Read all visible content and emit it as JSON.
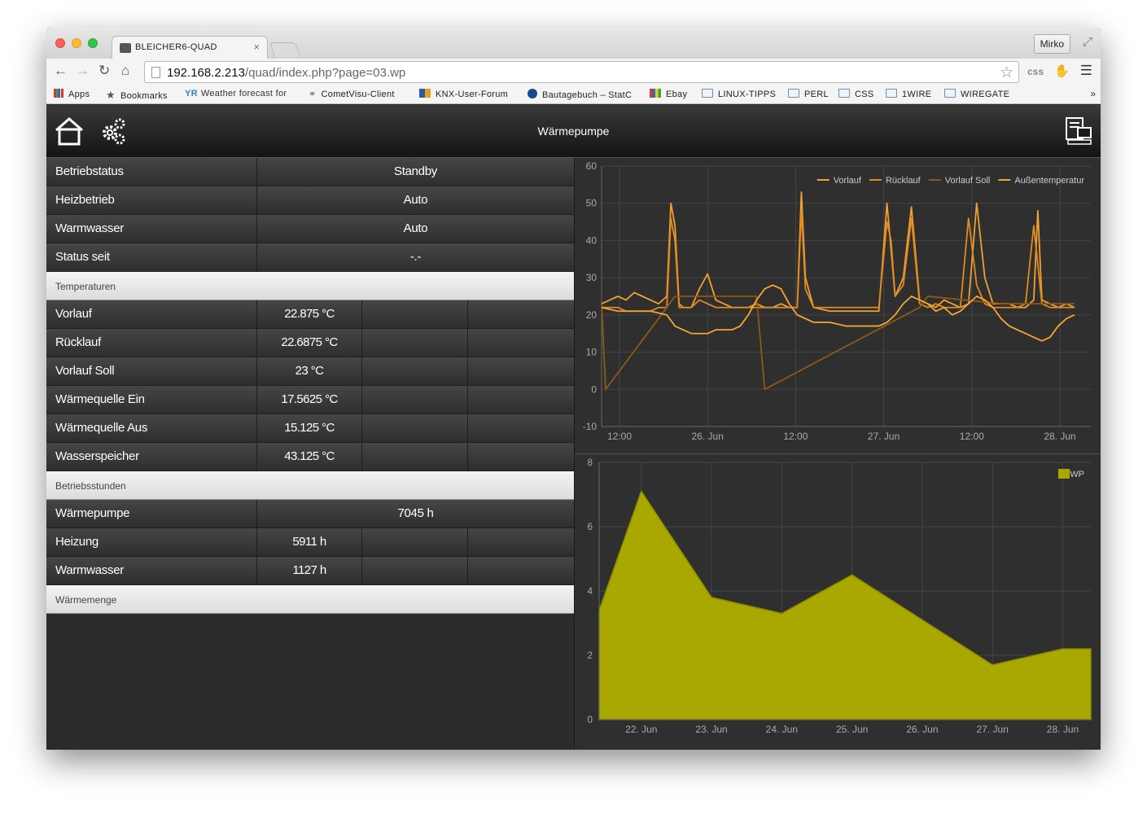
{
  "browser": {
    "tab_title": "BLEICHER6-QUAD",
    "profile": "Mirko",
    "url_host": "192.168.2.213",
    "url_path": "/quad/index.php?page=03.wp",
    "extension_label": "css",
    "bookmarks": [
      {
        "label": "Apps",
        "icon": "apps-grid-icon"
      },
      {
        "label": "Bookmarks",
        "icon": "star-icon"
      },
      {
        "label": "Weather forecast for",
        "icon": "yr-icon"
      },
      {
        "label": "CometVisu-Client",
        "icon": "link-icon"
      },
      {
        "label": "KNX-User-Forum",
        "icon": "knx-icon"
      },
      {
        "label": "Bautagebuch – StatC",
        "icon": "globe-icon"
      },
      {
        "label": "Ebay",
        "icon": "bag-icon"
      },
      {
        "label": "LINUX-TIPPS",
        "icon": "folder-icon"
      },
      {
        "label": "PERL",
        "icon": "folder-icon"
      },
      {
        "label": "CSS",
        "icon": "folder-icon"
      },
      {
        "label": "1WIRE",
        "icon": "folder-icon"
      },
      {
        "label": "WIREGATE",
        "icon": "folder-icon"
      }
    ]
  },
  "app": {
    "title": "Wärmepumpe"
  },
  "status_rows": [
    {
      "label": "Betriebstatus",
      "value": "Standby"
    },
    {
      "label": "Heizbetrieb",
      "value": "Auto"
    },
    {
      "label": "Warmwasser",
      "value": "Auto"
    },
    {
      "label": "Status seit",
      "value": "-.-"
    }
  ],
  "sections": {
    "temperaturen": "Temperaturen",
    "betriebsstunden": "Betriebsstunden",
    "waermemenge": "Wärmemenge"
  },
  "temperature_rows": [
    {
      "label": "Vorlauf",
      "value": "22.875 °C"
    },
    {
      "label": "Rücklauf",
      "value": "22.6875 °C"
    },
    {
      "label": "Vorlauf Soll",
      "value": "23 °C"
    },
    {
      "label": "Wärmequelle Ein",
      "value": "17.5625 °C"
    },
    {
      "label": "Wärmequelle Aus",
      "value": "15.125 °C"
    },
    {
      "label": "Wasserspeicher",
      "value": "43.125 °C"
    }
  ],
  "hours_main": {
    "label": "Wärmepumpe",
    "value": "7045 h"
  },
  "hours_rows": [
    {
      "label": "Heizung",
      "value": "5911 h"
    },
    {
      "label": "Warmwasser",
      "value": "1127 h"
    }
  ],
  "chart_data": [
    {
      "type": "line",
      "x_ticks": [
        "12:00",
        "26. Jun",
        "12:00",
        "27. Jun",
        "12:00",
        "28. Jun"
      ],
      "x_range": [
        0,
        60
      ],
      "ylim": [
        -10,
        60
      ],
      "y_ticks": [
        -10,
        0,
        10,
        20,
        30,
        40,
        50,
        60
      ],
      "grid": true,
      "legend_position": "top-right",
      "series": [
        {
          "name": "Vorlauf",
          "color": "#f0a030",
          "x": [
            0,
            1,
            2,
            3,
            4,
            5,
            6,
            7,
            8,
            8.5,
            9,
            9.5,
            10,
            11,
            12,
            13,
            14,
            15,
            16,
            17,
            18,
            19,
            20,
            21,
            22,
            23,
            24,
            24.5,
            25,
            26,
            28,
            30,
            32,
            34,
            35,
            36,
            37,
            38,
            39,
            40,
            41,
            42,
            43,
            44,
            45,
            46,
            47,
            48,
            49,
            50,
            51,
            52,
            53,
            53.5,
            54,
            55,
            56,
            57,
            58
          ],
          "y": [
            23,
            24,
            25,
            24,
            26,
            25,
            24,
            23,
            25,
            50,
            44,
            23,
            22,
            22,
            27,
            31,
            24,
            23,
            22,
            22,
            22,
            23,
            22,
            22,
            23,
            22,
            22,
            53,
            30,
            22,
            21,
            21,
            21,
            21,
            50,
            25,
            30,
            49,
            24,
            23,
            22,
            24,
            23,
            22,
            23,
            50,
            30,
            23,
            23,
            23,
            22,
            22,
            24,
            48,
            24,
            23,
            22,
            23,
            22
          ]
        },
        {
          "name": "Rücklauf",
          "color": "#e08a20",
          "x": [
            0,
            1,
            2,
            3,
            4,
            5,
            6,
            7,
            8,
            8.5,
            9,
            9.5,
            10,
            11,
            12,
            13,
            14,
            15,
            16,
            17,
            18,
            19,
            20,
            21,
            22,
            23,
            24,
            24.5,
            25,
            26,
            28,
            30,
            32,
            34,
            35,
            35.5,
            36,
            37,
            38,
            39,
            40,
            41,
            42,
            43,
            44,
            45,
            46,
            47,
            48,
            49,
            50,
            51,
            52,
            53,
            54,
            55,
            56,
            57,
            58
          ],
          "y": [
            22,
            22,
            22,
            21,
            21,
            21,
            21,
            22,
            22,
            46,
            40,
            22,
            22,
            22,
            24,
            23,
            22,
            22,
            22,
            22,
            22,
            22,
            22,
            22,
            22,
            22,
            22,
            48,
            27,
            22,
            22,
            22,
            22,
            22,
            45,
            40,
            25,
            28,
            46,
            23,
            22,
            23,
            22,
            22,
            22,
            46,
            28,
            23,
            22,
            22,
            22,
            22,
            23,
            44,
            23,
            22,
            22,
            22,
            22
          ]
        },
        {
          "name": "Vorlauf Soll",
          "color": "#8a5a18",
          "x": [
            0,
            0.5,
            8,
            9,
            19,
            20,
            39,
            40,
            49,
            50,
            58
          ],
          "y": [
            23,
            0,
            22,
            25,
            25,
            0,
            22,
            25,
            23,
            23,
            23
          ]
        },
        {
          "name": "Außentemperatur",
          "color": "#f6a432",
          "x": [
            0,
            2,
            4,
            6,
            8,
            9,
            10,
            11,
            12,
            13,
            14,
            15,
            16,
            17,
            18,
            19,
            20,
            21,
            22,
            23,
            24,
            25,
            26,
            28,
            30,
            32,
            34,
            35,
            36,
            37,
            38,
            39,
            40,
            41,
            42,
            43,
            44,
            45,
            46,
            47,
            48,
            49,
            50,
            51,
            52,
            53,
            54,
            55,
            56,
            57,
            58
          ],
          "y": [
            22,
            21,
            21,
            21,
            20,
            17,
            16,
            15,
            15,
            15,
            16,
            16,
            16,
            17,
            20,
            24,
            27,
            28,
            27,
            23,
            20,
            19,
            18,
            18,
            17,
            17,
            17,
            18,
            20,
            23,
            25,
            24,
            23,
            21,
            22,
            20,
            21,
            23,
            25,
            24,
            22,
            19,
            17,
            16,
            15,
            14,
            13,
            14,
            17,
            19,
            20
          ]
        }
      ]
    },
    {
      "type": "area",
      "categories": [
        "22. Jun",
        "23. Jun",
        "24. Jun",
        "25. Jun",
        "26. Jun",
        "27. Jun",
        "28. Jun"
      ],
      "ylim": [
        0,
        8
      ],
      "y_ticks": [
        0,
        2,
        4,
        6,
        8
      ],
      "grid": true,
      "legend_position": "top-right",
      "series": [
        {
          "name": "WP",
          "color": "#a8a800",
          "x": [
            -0.6,
            0,
            1,
            2,
            3,
            4,
            5,
            6,
            6.4
          ],
          "y": [
            3.4,
            7.1,
            3.8,
            3.3,
            4.5,
            3.1,
            1.7,
            2.2,
            2.2
          ]
        }
      ]
    }
  ]
}
